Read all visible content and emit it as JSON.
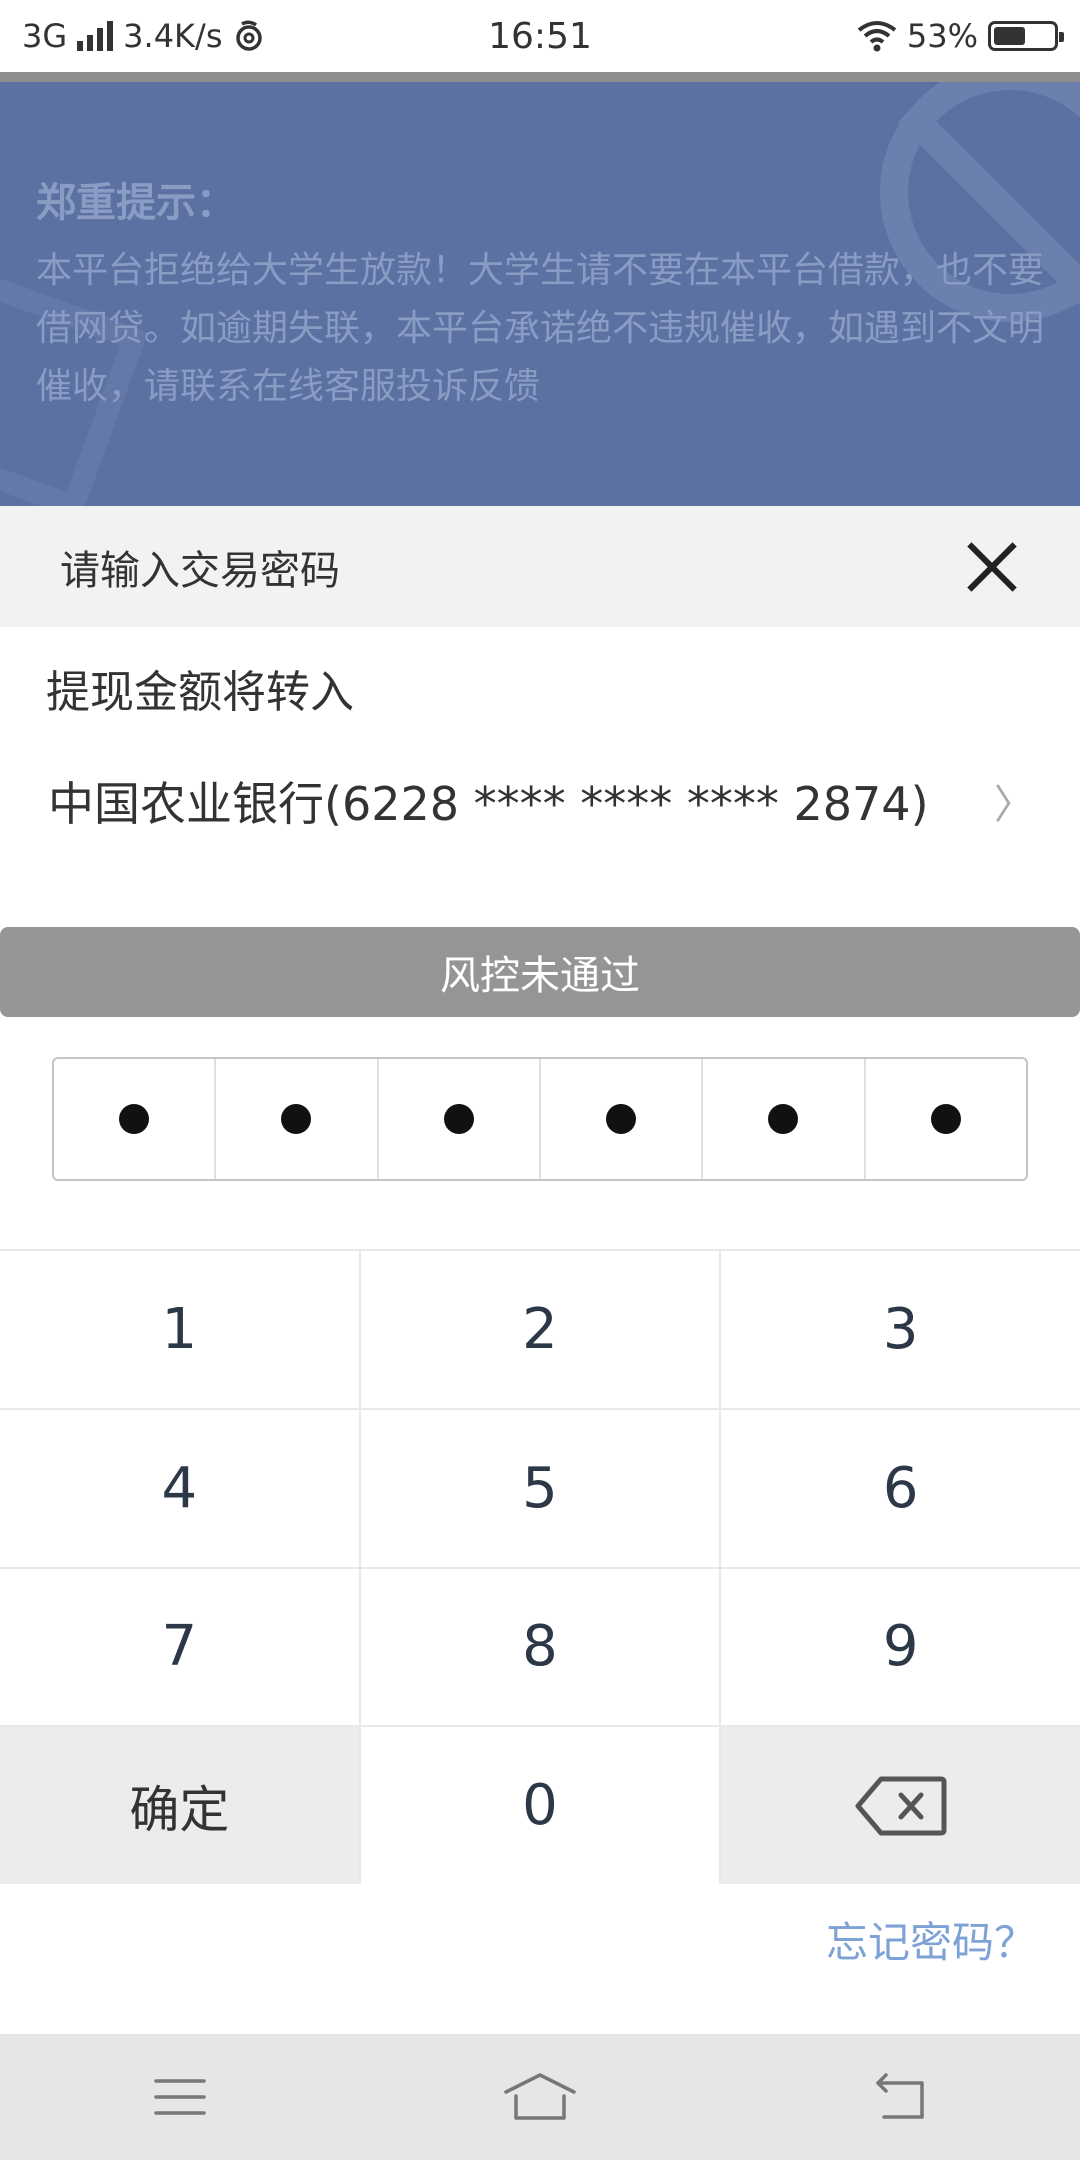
{
  "status_bar": {
    "network": "3G",
    "speed": "3.4K/s",
    "time": "16:51",
    "battery": "53%",
    "battery_level": 0.53
  },
  "banner": {
    "title": "郑重提示：",
    "text": "本平台拒绝给大学生放款！大学生请不要在本平台借款，也不要借网贷。如逾期失联，本平台承诺绝不违规催收，如遇到不文明催收，请联系在线客服投诉反馈"
  },
  "dialog": {
    "title": "请输入交易密码",
    "transfer_label": "提现金额将转入",
    "bank_account": "中国农业银行(6228 **** **** **** 2874)",
    "risk_status": "风控未通过",
    "pin_filled": 6
  },
  "keypad": {
    "keys": [
      "1",
      "2",
      "3",
      "4",
      "5",
      "6",
      "7",
      "8",
      "9"
    ],
    "confirm": "确定",
    "zero": "0"
  },
  "forgot_password": "忘记密码？",
  "colors": {
    "banner_bg": "#5b71a1",
    "risk_bar": "#959595",
    "link": "#7ea2d6"
  }
}
